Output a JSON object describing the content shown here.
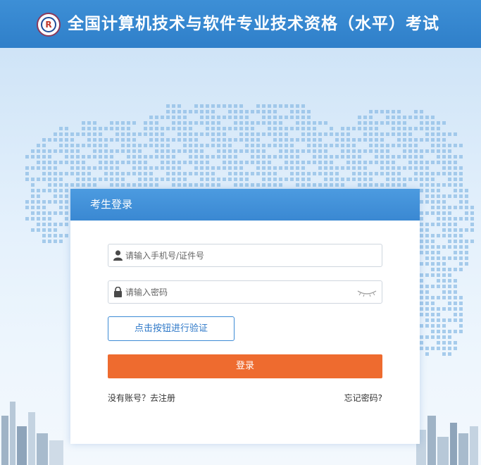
{
  "header": {
    "title": "全国计算机技术与软件专业技术资格（水平）考试",
    "logo_icon": "exam-logo-icon"
  },
  "login": {
    "title": "考生登录",
    "account_placeholder": "请输入手机号/证件号",
    "password_placeholder": "请输入密码",
    "verify_label": "点击按钮进行验证",
    "submit_label": "登录",
    "register_label": "没有账号？去注册",
    "forgot_label": "忘记密码?"
  },
  "colors": {
    "header": "#3d8fd6",
    "card_header": "#4c9be0",
    "login_button": "#ee6b2f",
    "verify_border": "#3d8bd5"
  },
  "icons": {
    "account": "user-icon",
    "password": "lock-icon",
    "visibility": "eye-closed-icon"
  }
}
